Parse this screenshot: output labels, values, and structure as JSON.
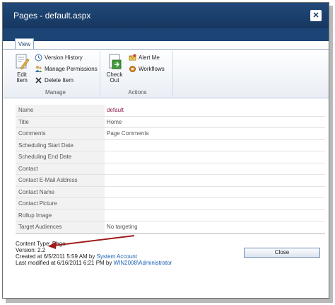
{
  "window": {
    "title": "Pages - default.aspx",
    "close_glyph": "✕"
  },
  "ribbon": {
    "tab": "View",
    "manage": {
      "label": "Manage",
      "edit_item": "Edit Item",
      "version_history": "Version History",
      "manage_permissions": "Manage Permissions",
      "delete_item": "Delete Item"
    },
    "actions": {
      "label": "Actions",
      "check_out": "Check Out",
      "alert_me": "Alert Me",
      "workflows": "Workflows"
    }
  },
  "properties": [
    {
      "label": "Name",
      "value": "default",
      "link": true
    },
    {
      "label": "Title",
      "value": "Home",
      "link": false
    },
    {
      "label": "Comments",
      "value": "Page Comments",
      "link": false
    },
    {
      "label": "Scheduling Start Date",
      "value": "",
      "link": false
    },
    {
      "label": "Scheduling End Date",
      "value": "",
      "link": false
    },
    {
      "label": "Contact",
      "value": "",
      "link": false
    },
    {
      "label": "Contact E-Mail Address",
      "value": "",
      "link": false
    },
    {
      "label": "Contact Name",
      "value": "",
      "link": false
    },
    {
      "label": "Contact Picture",
      "value": "",
      "link": false
    },
    {
      "label": "Rollup Image",
      "value": "",
      "link": false
    },
    {
      "label": "Target Audiences",
      "value": "No targeting",
      "link": false
    }
  ],
  "footer": {
    "content_type": "Content Type: Page",
    "version": "Version: 2.2",
    "created_prefix": "Created at 6/5/2011 5:59 AM  by ",
    "created_by": "System Account",
    "modified_prefix": "Last modified at 6/16/2011 6:21 PM  by ",
    "modified_by": "WIN2008\\Administrator"
  },
  "buttons": {
    "close": "Close"
  },
  "colors": {
    "titlebar": "#163760",
    "link": "#1a5fb4",
    "name_link": "#8b1a4a",
    "arrow": "#a01c1c"
  },
  "icons": [
    "edit-item-icon",
    "version-history-icon",
    "manage-permissions-icon",
    "delete-item-icon",
    "check-out-icon",
    "alert-me-icon",
    "workflows-icon",
    "close-icon",
    "annotation-arrow"
  ]
}
